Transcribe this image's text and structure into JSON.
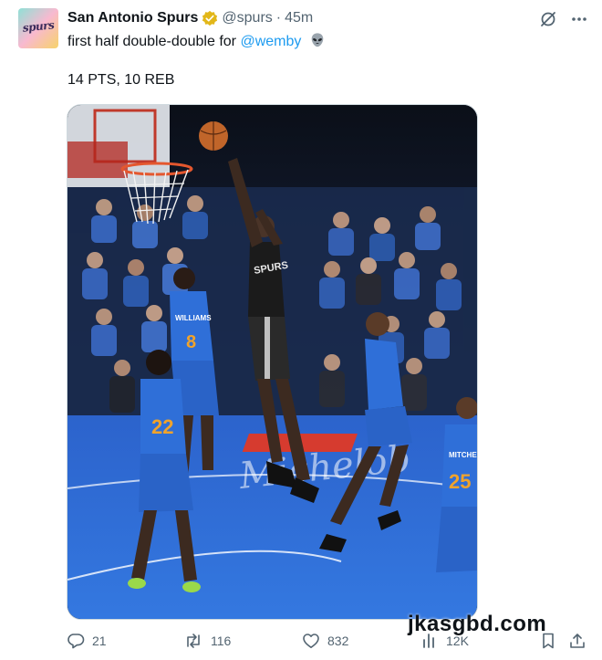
{
  "tweet": {
    "author_name": "San Antonio Spurs",
    "handle": "@spurs",
    "separator": "·",
    "time": "45m",
    "text_before": "first half double-double for ",
    "mention": "@wemby",
    "stats": "14 PTS, 10 REB",
    "avatar_text": "spurs"
  },
  "actions": {
    "replies": "21",
    "reposts": "116",
    "likes": "832",
    "views": "12K"
  },
  "watermark": "jkasgbd.com",
  "colors": {
    "accent": "#1d9bf0",
    "verified": "#e2b719",
    "okc_blue": "#2f6fd8",
    "spurs_black": "#1b1b1b"
  },
  "icons": [
    "grok-icon",
    "more-icon",
    "reply-icon",
    "repost-icon",
    "like-icon",
    "views-icon",
    "bookmark-icon",
    "share-icon"
  ],
  "media": {
    "jersey_numbers": [
      "8",
      "22",
      "25"
    ],
    "jersey_names": [
      "WILLIAMS",
      "MITCHELL"
    ],
    "jersey_text": "SPURS",
    "court_text": "Michelob"
  }
}
